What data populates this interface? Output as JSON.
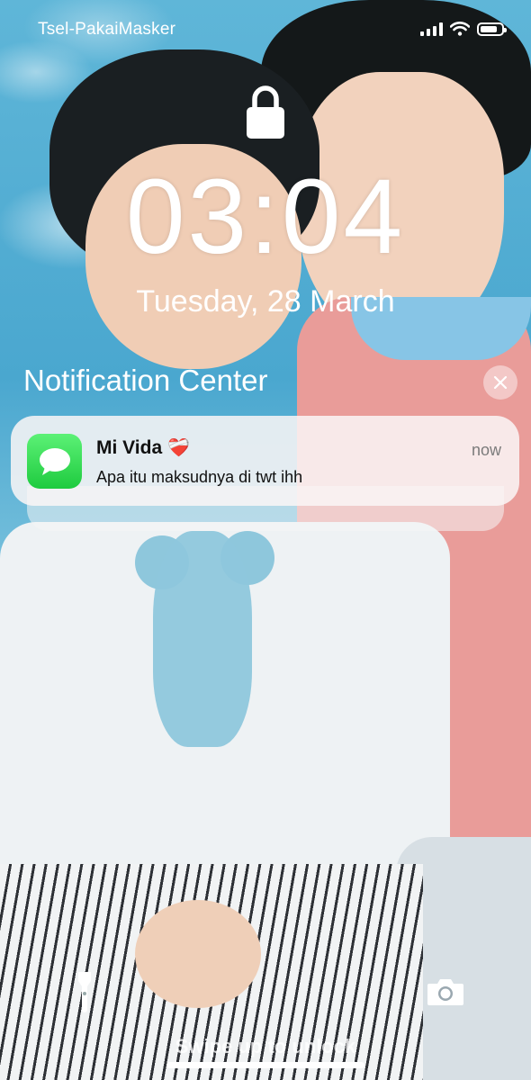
{
  "status_bar": {
    "carrier": "Tsel-PakaiMasker",
    "battery_level": 0.8
  },
  "lock_screen": {
    "time": "03:04",
    "date": "Tuesday, 28 March"
  },
  "notification_center": {
    "title": "Notification Center",
    "clear_icon": "close-icon"
  },
  "notification": {
    "app_icon": "messages-icon",
    "sender": "Mi Vida",
    "sender_emoji": "❤️‍🩹",
    "time": "now",
    "message": "Apa itu maksudnya di twt ihh"
  },
  "bottom": {
    "left_icon": "flashlight-icon",
    "right_icon": "camera-icon",
    "swipe_text": "Swipe up to unlock"
  }
}
